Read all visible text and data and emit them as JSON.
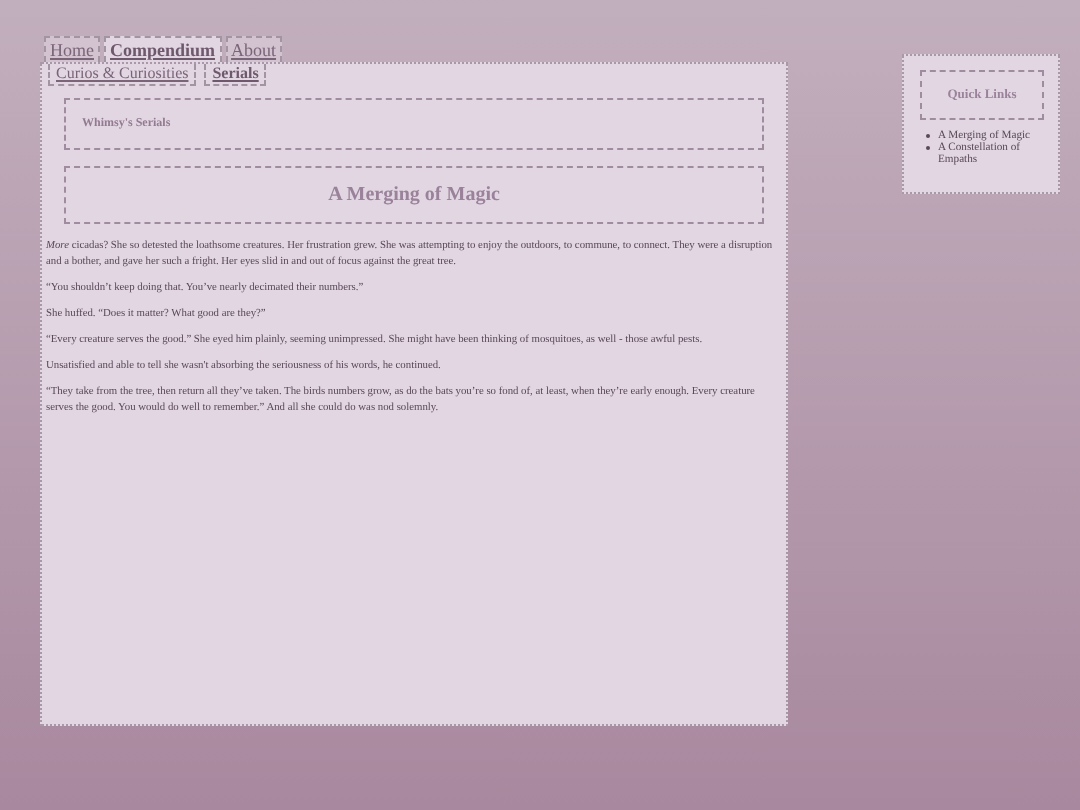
{
  "tabs": [
    {
      "label": "Home",
      "selected": false
    },
    {
      "label": "Compendium",
      "selected": true
    },
    {
      "label": "About",
      "selected": false
    }
  ],
  "subtabs": [
    {
      "label": "Curios & Curiosities",
      "selected": false
    },
    {
      "label": "Serials",
      "selected": true
    }
  ],
  "section_title": "Whimsy's Serials",
  "story_title": "A Merging of Magic",
  "paragraphs": [
    "*More* cicadas? She so detested the loathsome creatures. Her frustration grew. She was attempting to enjoy the outdoors, to commune, to connect. They were a disruption and a bother, and gave her such a fright. Her eyes slid in and out of focus against the great tree.",
    "“You shouldn’t keep doing that. You’ve nearly decimated their numbers.”",
    "She huffed. “Does it matter? What good are they?”",
    "“Every creature serves the good.” She eyed him plainly, seeming unimpressed. She might have been thinking of mosquitoes, as well - those awful pests.",
    "Unsatisfied and able to tell she wasn't absorbing the seriousness of his words, he continued.",
    "“They take from the tree, then return all they’ve taken. The birds numbers grow, as do the bats you’re so fond of, at least, when they’re early enough. Every creature serves the good. You would do well to remember.” And all she could do was nod solemnly."
  ],
  "quick_links": {
    "title": "Quick Links",
    "items": [
      "A Merging of Magic",
      "A Constellation of Empaths"
    ]
  }
}
